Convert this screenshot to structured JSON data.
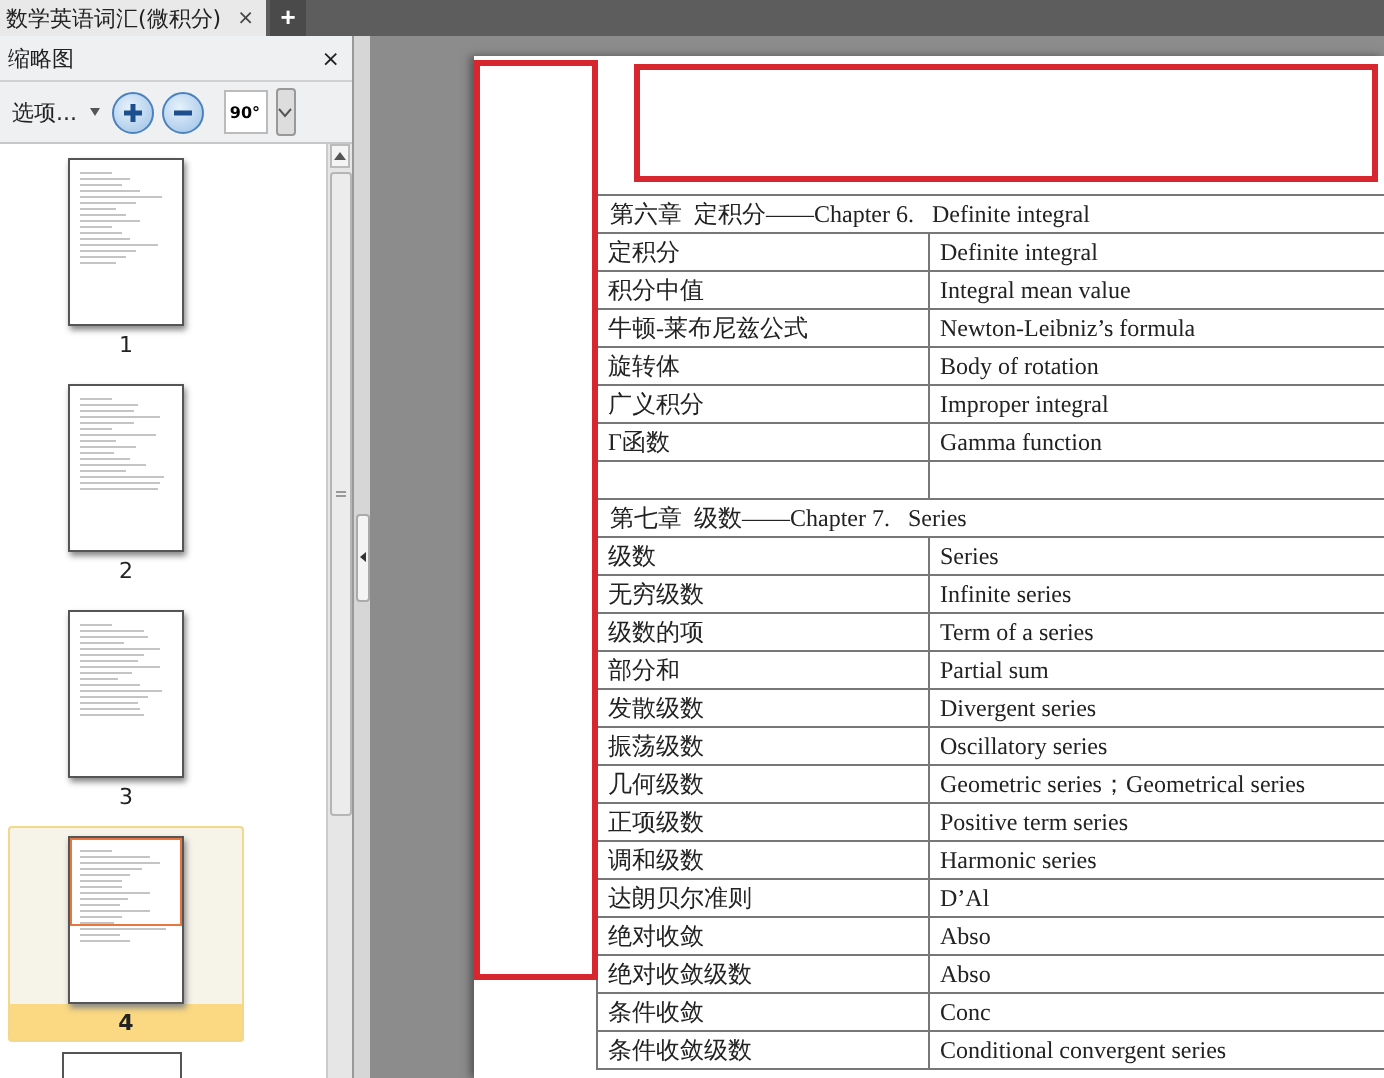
{
  "tabs": [
    {
      "label": "数学英语词汇(微积分)",
      "close": "×",
      "selected": true
    }
  ],
  "new_tab": "+",
  "sidebar": {
    "title": "缩略图",
    "close": "×",
    "options": "选项...",
    "rotate_label": "90°",
    "thumbnails": [
      {
        "label": "1",
        "selected": false
      },
      {
        "label": "2",
        "selected": false
      },
      {
        "label": "3",
        "selected": false
      },
      {
        "label": "4",
        "selected": true
      }
    ]
  },
  "document": {
    "sections": [
      {
        "heading": "第六章  定积分——Chapter 6.   Definite integral",
        "rows": [
          {
            "kind": "term",
            "zh": "定积分",
            "en": "Definite integral"
          },
          {
            "kind": "term",
            "zh": "积分中值",
            "en": "Integral mean value"
          },
          {
            "kind": "term",
            "zh": "牛顿-莱布尼兹公式",
            "en": "Newton-Leibniz’s formula"
          },
          {
            "kind": "term",
            "zh": "旋转体",
            "en": "Body of rotation"
          },
          {
            "kind": "term",
            "zh": "广义积分",
            "en": "Improper integral"
          },
          {
            "kind": "term",
            "zh": "Γ函数",
            "en": "Gamma function"
          },
          {
            "kind": "blank"
          }
        ]
      },
      {
        "heading": "第七章  级数——Chapter 7.   Series",
        "rows": [
          {
            "kind": "term",
            "zh": "级数",
            "en": "Series"
          },
          {
            "kind": "term",
            "zh": "无穷级数",
            "en": "Infinite series"
          },
          {
            "kind": "term",
            "zh": "级数的项",
            "en": "Term of a series"
          },
          {
            "kind": "term",
            "zh": "部分和",
            "en": "Partial sum"
          },
          {
            "kind": "term",
            "zh": "发散级数",
            "en": "Divergent series"
          },
          {
            "kind": "term",
            "zh": "振荡级数",
            "en": "Oscillatory series"
          },
          {
            "kind": "term",
            "zh": "几何级数",
            "en": "Geometric series；Geometrical series"
          },
          {
            "kind": "term",
            "zh": "正项级数",
            "en": "Positive term series"
          },
          {
            "kind": "term",
            "zh": "调和级数",
            "en": "Harmonic series"
          },
          {
            "kind": "term",
            "zh": "达朗贝尔准则",
            "en": "D’Al"
          },
          {
            "kind": "term",
            "zh": "绝对收敛",
            "en": "Abso"
          },
          {
            "kind": "term",
            "zh": "绝对收敛级数",
            "en": "Abso"
          },
          {
            "kind": "term",
            "zh": "条件收敛",
            "en": "Conc"
          },
          {
            "kind": "term",
            "zh": "条件收敛级数",
            "en": "Conditional convergent series"
          }
        ]
      }
    ]
  }
}
